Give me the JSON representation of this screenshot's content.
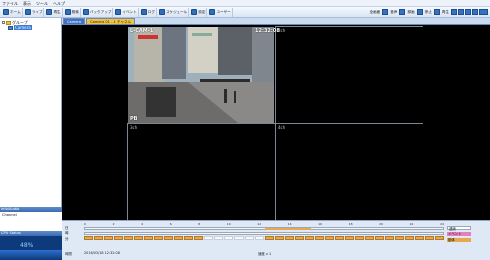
{
  "menu": [
    "ファイル",
    "表示",
    "ツール",
    "ヘルプ"
  ],
  "toolbar": [
    {
      "icon": "layout-icon",
      "label": "ホーム"
    },
    {
      "icon": "live-icon",
      "label": "ライブ"
    },
    {
      "icon": "playback-icon",
      "label": "再生"
    },
    {
      "icon": "search-icon",
      "label": "検索"
    },
    {
      "icon": "backup-icon",
      "label": "バックアップ"
    },
    {
      "icon": "event-icon",
      "label": "イベント"
    },
    {
      "icon": "log-icon",
      "label": "ログ"
    },
    {
      "icon": "schedule-icon",
      "label": "スケジュール"
    },
    {
      "icon": "setup-icon",
      "label": "設定"
    },
    {
      "icon": "user-icon",
      "label": "ユーザー"
    }
  ],
  "toolbar_right": [
    "全画面",
    "音声",
    "録画",
    "停止",
    "再生"
  ],
  "tree": {
    "root": "グループ",
    "camera": "Camera"
  },
  "panels": {
    "info_header": "Info/Audio",
    "info_value": "Channel",
    "cpu_header": "CPU Status",
    "cpu_value": "48%"
  },
  "tabs": [
    "Camera",
    "Camera 01 - 1 チャネル"
  ],
  "video": {
    "cam_label": "L-CAM-1",
    "timestamp": "12:32:08",
    "mode": "PB",
    "cells": [
      "2ch",
      "3ch",
      "4ch"
    ]
  },
  "timeline": {
    "ticks": [
      "0",
      "2",
      "4",
      "6",
      "8",
      "10",
      "12",
      "14",
      "16",
      "18",
      "20",
      "22",
      "24"
    ],
    "row_labels": [
      "日",
      "時",
      "分"
    ],
    "legend": [
      "連続",
      "イベント",
      "動体"
    ],
    "date": "2016/03/18 12:32:08",
    "footer_left": "時間",
    "footer_right": "速度 x 1"
  },
  "colors": {
    "accent": "#3e74c3",
    "warning": "#f2c13f",
    "record": "#e9a84c"
  }
}
